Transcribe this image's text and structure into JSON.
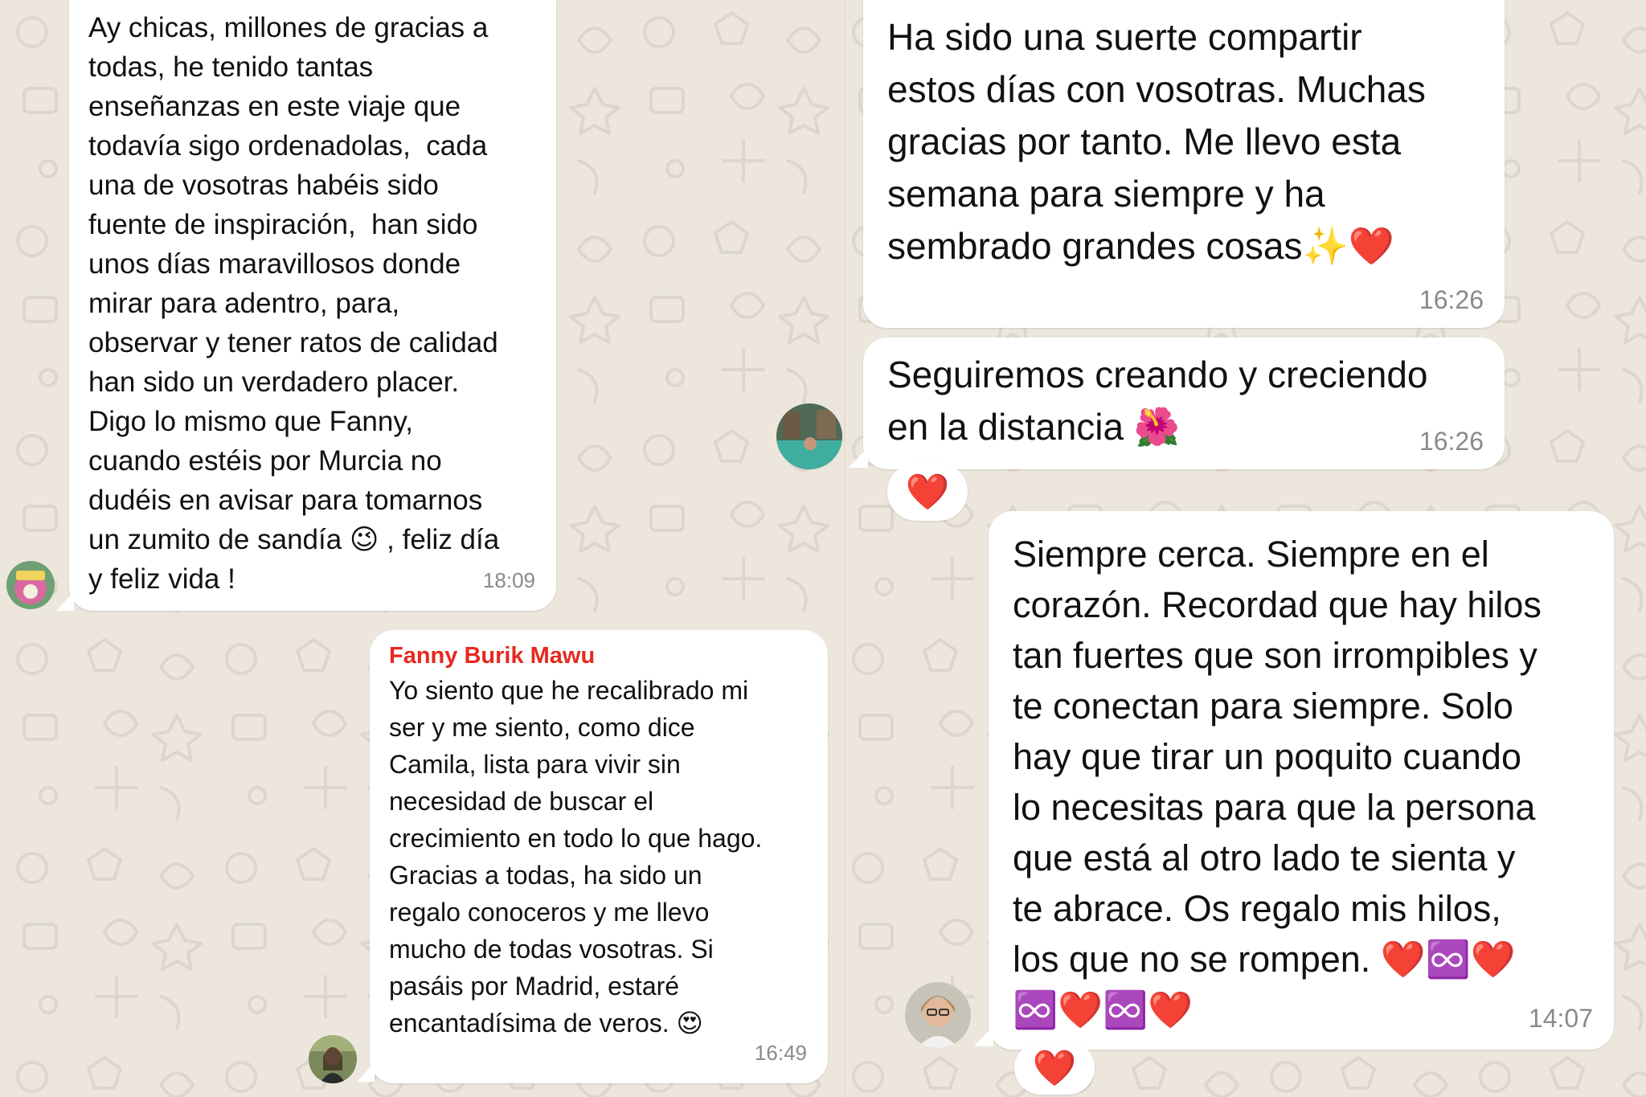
{
  "colors": {
    "wallpaper": "#ece6dd",
    "bubble": "#ffffff",
    "sender_name": "#e5291f",
    "heart": "#e1141c",
    "timestamp": "#8a8a8a"
  },
  "messages": [
    {
      "text": "Ay chicas, millones de gracias a\ntodas, he tenido tantas\nenseñanzas en este viaje que\ntodavía sigo ordenadolas,  cada\nuna de vosotras habéis sido\nfuente de inspiración,  han sido\nunos días maravillosos donde\nmirar para adentro, para,\nobservar y tener ratos de calidad\nhan sido un verdadero placer.\nDigo lo mismo que Fanny,\ncuando estéis por Murcia no\ndudéis en avisar para tomarnos\nun zumito de sandía 😉 , feliz día\ny feliz vida !",
      "time": "18:09"
    },
    {
      "sender": "Fanny Burik Mawu",
      "text": "Yo siento que he recalibrado mi\nser y me siento, como dice\nCamila, lista para vivir sin\nnecesidad de buscar el\ncrecimiento en todo lo que hago.\nGracias a todas, ha sido un\nregalo conoceros y me llevo\nmucho de todas vosotras. Si\npasáis por Madrid, estaré\nencantadísima de veros. 😍",
      "time": "16:49"
    },
    {
      "text": "Ha sido una suerte compartir\nestos días con vosotras. Muchas\ngracias por tanto. Me llevo esta\nsemana para siempre y ha\nsembrado grandes cosas✨❤️",
      "time": "16:26"
    },
    {
      "text": "Seguiremos creando y creciendo\nen la distancia 🌺",
      "time": "16:26",
      "reaction": "❤️"
    },
    {
      "text": "Siempre cerca. Siempre en el\ncorazón. Recordad que hay hilos\ntan fuertes que son irrompibles y\nte conectan para siempre. Solo\nhay que tirar un poquito cuando\nlo necesitas para que la persona\nque está al otro lado te sienta y\nte abrace. Os regalo mis hilos,\nlos que no se rompen. ❤️♾️❤️\n♾️❤️♾️❤️",
      "time": "14:07",
      "reaction": "❤️"
    }
  ],
  "avatars": [
    {
      "icon": "profile-photo-icon",
      "desc_id": "avatar-love-sticker"
    },
    {
      "icon": "profile-photo-icon",
      "desc_id": "avatar-woman-portrait"
    },
    {
      "icon": "profile-photo-icon",
      "desc_id": "avatar-pool-photo"
    },
    {
      "icon": "profile-photo-icon",
      "desc_id": "avatar-woman-glasses"
    }
  ]
}
